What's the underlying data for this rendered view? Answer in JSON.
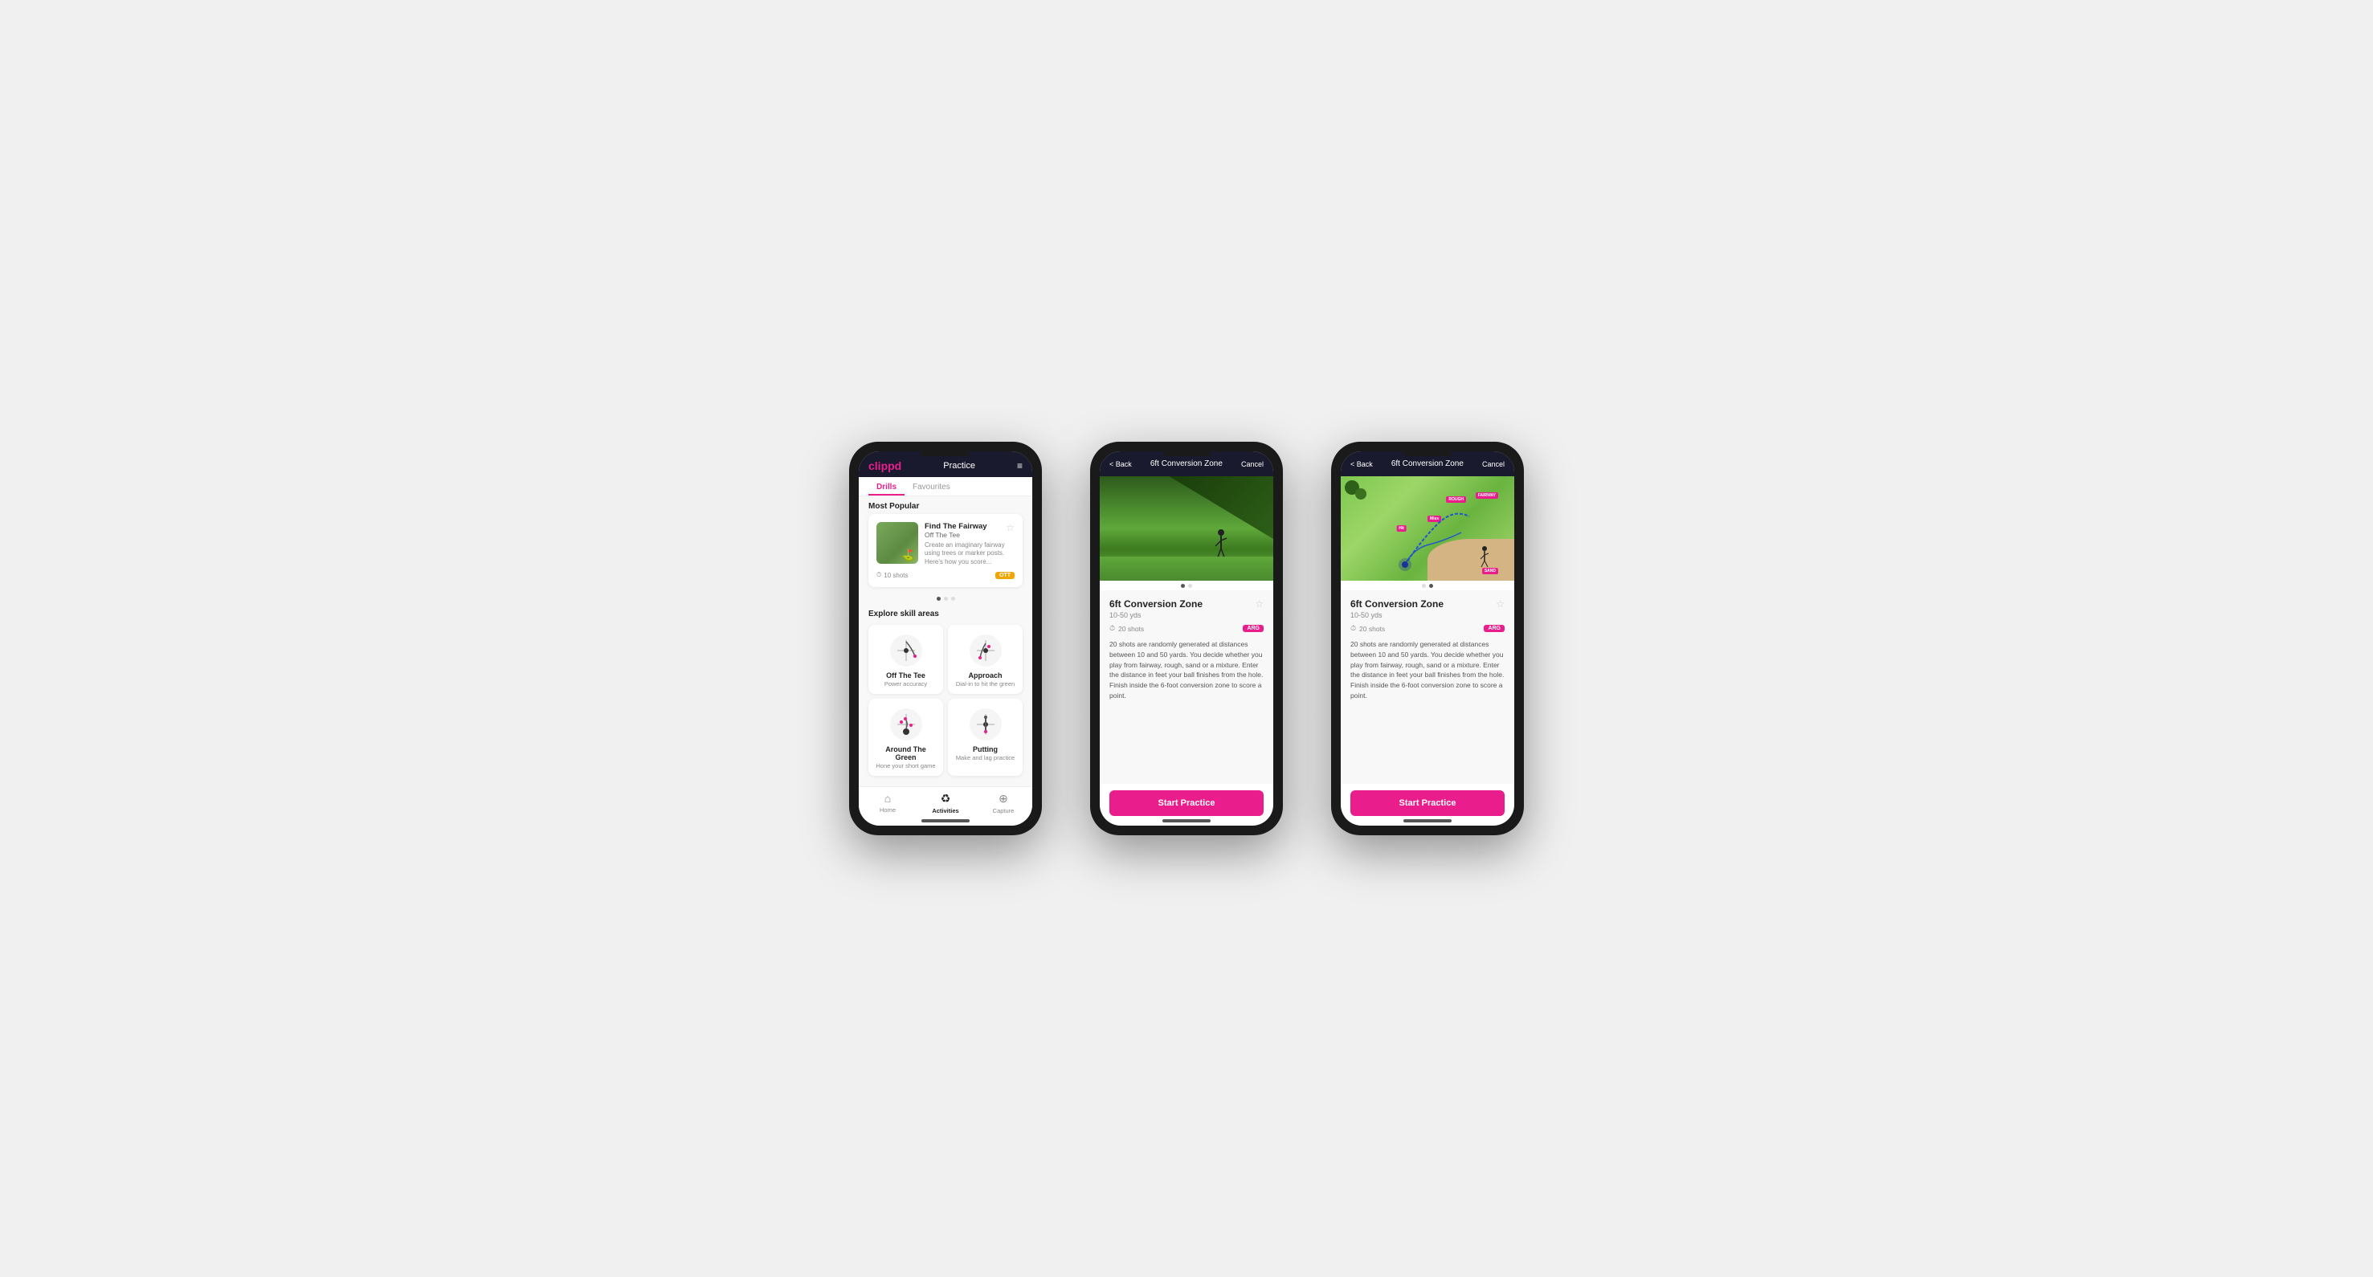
{
  "phones": {
    "phone1": {
      "header": {
        "logo": "clippd",
        "title": "Practice",
        "menu_icon": "≡"
      },
      "tabs": [
        {
          "label": "Drills",
          "active": true
        },
        {
          "label": "Favourites",
          "active": false
        }
      ],
      "most_popular_label": "Most Popular",
      "drill_card": {
        "title": "Find The Fairway",
        "subtitle": "Off The Tee",
        "description": "Create an imaginary fairway using trees or marker posts. Here's how you score...",
        "shots": "10 shots",
        "tag": "OTT"
      },
      "explore_label": "Explore skill areas",
      "skill_areas": [
        {
          "name": "Off The Tee",
          "desc": "Power accuracy"
        },
        {
          "name": "Approach",
          "desc": "Dial-in to hit the green"
        },
        {
          "name": "Around The Green",
          "desc": "Hone your short game"
        },
        {
          "name": "Putting",
          "desc": "Make and lag practice"
        }
      ],
      "bottom_nav": [
        {
          "label": "Home",
          "icon": "⌂",
          "active": false
        },
        {
          "label": "Activities",
          "icon": "♻",
          "active": true
        },
        {
          "label": "Capture",
          "icon": "⊕",
          "active": false
        }
      ]
    },
    "phone2": {
      "header": {
        "back": "< Back",
        "title": "6ft Conversion Zone",
        "cancel": "Cancel"
      },
      "drill": {
        "title": "6ft Conversion Zone",
        "yardage": "10-50 yds",
        "shots": "20 shots",
        "tag": "ARG",
        "description": "20 shots are randomly generated at distances between 10 and 50 yards. You decide whether you play from fairway, rough, sand or a mixture. Enter the distance in feet your ball finishes from the hole. Finish inside the 6-foot conversion zone to score a point."
      },
      "start_practice": "Start Practice",
      "image_type": "photo"
    },
    "phone3": {
      "header": {
        "back": "< Back",
        "title": "6ft Conversion Zone",
        "cancel": "Cancel"
      },
      "drill": {
        "title": "6ft Conversion Zone",
        "yardage": "10-50 yds",
        "shots": "20 shots",
        "tag": "ARG",
        "description": "20 shots are randomly generated at distances between 10 and 50 yards. You decide whether you play from fairway, rough, sand or a mixture. Enter the distance in feet your ball finishes from the hole. Finish inside the 6-foot conversion zone to score a point."
      },
      "start_practice": "Start Practice",
      "image_type": "map"
    }
  }
}
